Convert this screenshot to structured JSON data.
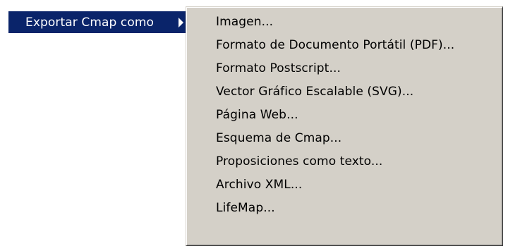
{
  "parent_menu": {
    "item_label": "Exportar Cmap como"
  },
  "submenu": {
    "items": [
      {
        "label": "Imagen..."
      },
      {
        "label": "Formato de Documento Portátil (PDF)..."
      },
      {
        "label": "Formato Postscript..."
      },
      {
        "label": "Vector Gráfico Escalable (SVG)..."
      },
      {
        "label": "Página Web..."
      },
      {
        "label": "Esquema de Cmap..."
      },
      {
        "label": "Proposiciones como texto..."
      },
      {
        "label": "Archivo XML..."
      },
      {
        "label": "LifeMap..."
      }
    ]
  },
  "colors": {
    "highlight": "#0a246a",
    "menu_background": "#d4d0c8",
    "highlight_text": "#ffffff",
    "menu_text": "#000000"
  }
}
